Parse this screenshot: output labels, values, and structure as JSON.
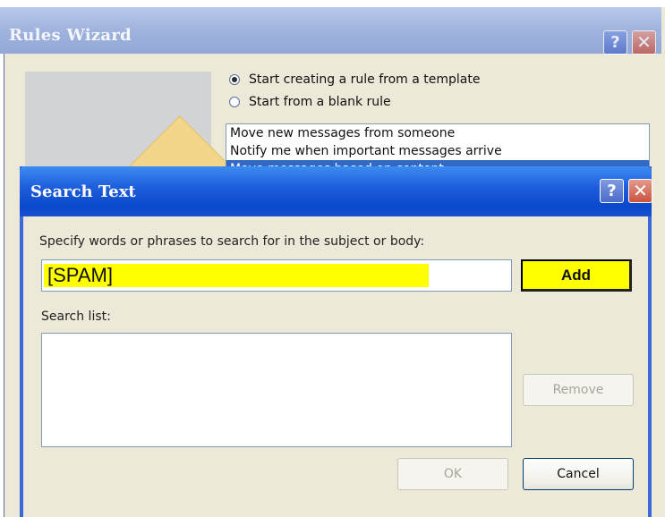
{
  "rules_wizard": {
    "title": "Rules Wizard",
    "help_glyph": "?",
    "close_glyph": "✕",
    "options": [
      {
        "label": "Start creating a rule from a template",
        "checked": true
      },
      {
        "label": "Start from a blank rule",
        "checked": false
      }
    ],
    "templates": [
      {
        "label": "Move new messages from someone",
        "selected": false
      },
      {
        "label": "Notify me when important messages arrive",
        "selected": false
      },
      {
        "label": "Move messages based on content",
        "selected": true
      }
    ]
  },
  "search_text": {
    "title": "Search Text",
    "help_glyph": "?",
    "close_glyph": "✕",
    "instructions": "Specify words or phrases to search for in the subject or body:",
    "input_value": "[SPAM]",
    "add_label": "Add",
    "search_list_label": "Search list:",
    "search_list_items": [],
    "remove_label": "Remove",
    "ok_label": "OK",
    "cancel_label": "Cancel"
  },
  "colors": {
    "highlight": "#ffff00",
    "titlebar_active": "#0a48cc",
    "selection": "#316ac5"
  }
}
